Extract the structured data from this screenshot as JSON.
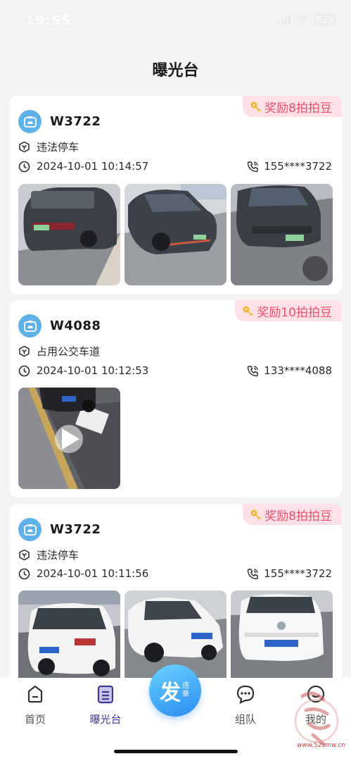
{
  "status_bar": {
    "time": "19:55",
    "battery": "33"
  },
  "page": {
    "title": "曝光台"
  },
  "cards": [
    {
      "reward": "奖励8拍拍豆",
      "user": "W3722",
      "violation": "违法停车",
      "datetime": "2024-10-01 10:14:57",
      "phone": "155****3722"
    },
    {
      "reward": "奖励10拍拍豆",
      "user": "W4088",
      "violation": "占用公交车道",
      "datetime": "2024-10-01 10:12:53",
      "phone": "133****4088"
    },
    {
      "reward": "奖励8拍拍豆",
      "user": "W3722",
      "violation": "违法停车",
      "datetime": "2024-10-01 10:11:56",
      "phone": "155****3722"
    }
  ],
  "tabbar": {
    "home": "首页",
    "exposure": "曝光台",
    "post_main": "发",
    "post_sub": "违章",
    "team": "组队",
    "mine": "我的"
  },
  "watermark": {
    "url": "www.52smw.cn"
  },
  "colors": {
    "accent": "#3c3b8f",
    "reward_bg": "#fde1e6",
    "reward_text": "#ef4f6f",
    "fab": "#2a8cf0"
  }
}
